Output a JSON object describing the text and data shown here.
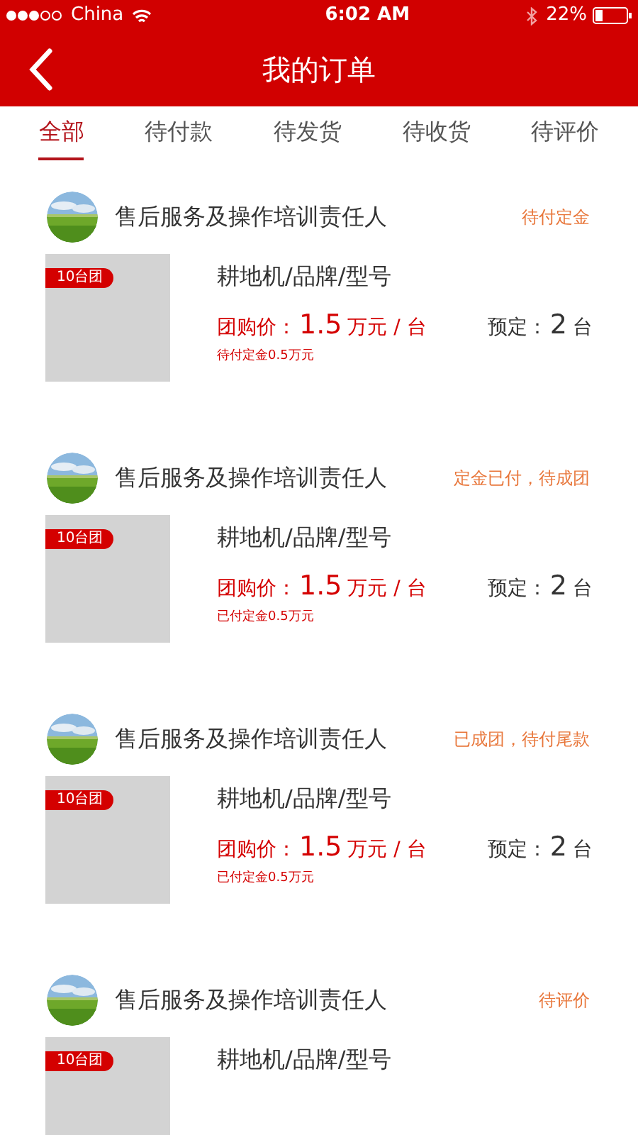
{
  "status_bar": {
    "carrier": "China",
    "time": "6:02 AM",
    "battery": "22%"
  },
  "header": {
    "title": "我的订单"
  },
  "tabs": [
    {
      "label": "全部",
      "selected": true
    },
    {
      "label": "待付款",
      "selected": false
    },
    {
      "label": "待发货",
      "selected": false
    },
    {
      "label": "待收货",
      "selected": false
    },
    {
      "label": "待评价",
      "selected": false
    }
  ],
  "orders": [
    {
      "seller": "售后服务及操作培训责任人",
      "status": "待付定金",
      "badge": "10台团",
      "product": "耕地机/品牌/型号",
      "price_label": "团购价：",
      "price": "1.5",
      "price_unit": "万元 / 台",
      "reserve_label": "预定：",
      "reserve_qty": "2",
      "reserve_unit": "台",
      "deposit": "待付定金0.5万元"
    },
    {
      "seller": "售后服务及操作培训责任人",
      "status": "定金已付，待成团",
      "badge": "10台团",
      "product": "耕地机/品牌/型号",
      "price_label": "团购价：",
      "price": "1.5",
      "price_unit": "万元 / 台",
      "reserve_label": "预定：",
      "reserve_qty": "2",
      "reserve_unit": "台",
      "deposit": "已付定金0.5万元"
    },
    {
      "seller": "售后服务及操作培训责任人",
      "status": "已成团，待付尾款",
      "badge": "10台团",
      "product": "耕地机/品牌/型号",
      "price_label": "团购价：",
      "price": "1.5",
      "price_unit": "万元 / 台",
      "reserve_label": "预定：",
      "reserve_qty": "2",
      "reserve_unit": "台",
      "deposit": "已付定金0.5万元"
    },
    {
      "seller": "售后服务及操作培训责任人",
      "status": "待评价",
      "badge": "10台团",
      "product": "耕地机/品牌/型号"
    }
  ]
}
